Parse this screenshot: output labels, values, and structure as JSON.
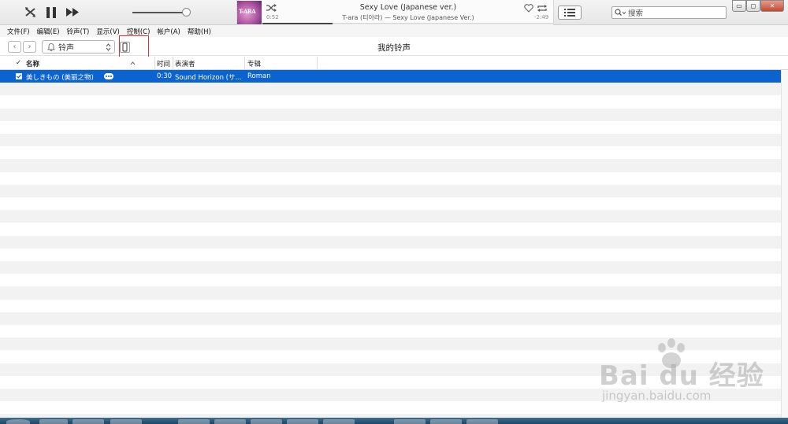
{
  "player": {
    "song_title": "Sexy Love (Japanese ver.)",
    "song_subtitle": "T-ara (티아라) — Sexy Love (Japanese Ver.)",
    "elapsed": "0:52",
    "remaining": "-2:49",
    "progress_fraction": 0.24,
    "volume_fraction": 0.9,
    "album_art_text": "T-ARA"
  },
  "search": {
    "placeholder": "搜索"
  },
  "menu": [
    "文件(F)",
    "编辑(E)",
    "铃声(T)",
    "显示(V)",
    "控制(C)",
    "帐户(A)",
    "帮助(H)"
  ],
  "nav": {
    "media_kind": "铃声",
    "page_title": "我的铃声"
  },
  "columns": {
    "check": "✓",
    "name": "名称",
    "time": "时间",
    "artist": "表演者",
    "album": "专辑"
  },
  "tracks": [
    {
      "name": "美しきもの (美丽之物)",
      "time": "0:30",
      "artist": "Sound Horizon (サ…",
      "album": "Roman",
      "selected": true
    }
  ],
  "watermark": {
    "brand": "Bai du 经验",
    "url": "jingyan.baidu.com"
  },
  "colors": {
    "selection": "#0b63cf",
    "highlight_box": "#e03030"
  }
}
